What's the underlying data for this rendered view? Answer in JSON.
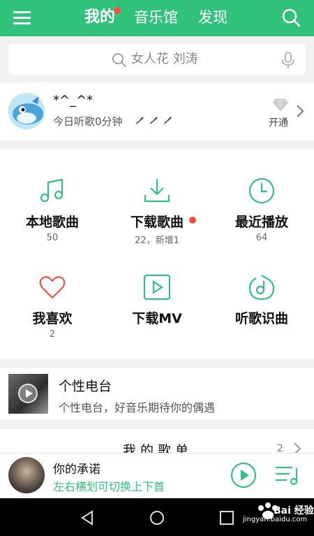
{
  "header": {
    "tabs": [
      "我的",
      "音乐馆",
      "发现"
    ],
    "active_tab": "我的",
    "accent_color": "#31c27c",
    "badge_color": "#ff4d3a"
  },
  "search": {
    "placeholder": "女人花 刘涛"
  },
  "profile": {
    "username": "*^_^*",
    "listen_today": "今日听歌0分钟",
    "vip_label": "开通"
  },
  "grid": [
    {
      "label": "本地歌曲",
      "count": "50",
      "icon": "music-note-icon"
    },
    {
      "label": "下载歌曲",
      "count": "22，新增1",
      "icon": "download-icon",
      "has_dot": true
    },
    {
      "label": "最近播放",
      "count": "64",
      "icon": "clock-icon"
    },
    {
      "label": "我喜欢",
      "count": "2",
      "icon": "heart-icon"
    },
    {
      "label": "下载MV",
      "count": "",
      "icon": "mv-play-icon"
    },
    {
      "label": "听歌识曲",
      "count": "",
      "icon": "music-recognize-icon"
    }
  ],
  "radio": {
    "title": "个性电台",
    "subtitle": "个性电台，好音乐期待你的偶遇"
  },
  "playlist": {
    "title": "我的歌单",
    "count": "2"
  },
  "player": {
    "song_title": "你的承诺",
    "hint": "左右横划可切换上下首"
  },
  "watermark": {
    "text": "Bai 经验",
    "url": "jingyan.baidu.com"
  }
}
